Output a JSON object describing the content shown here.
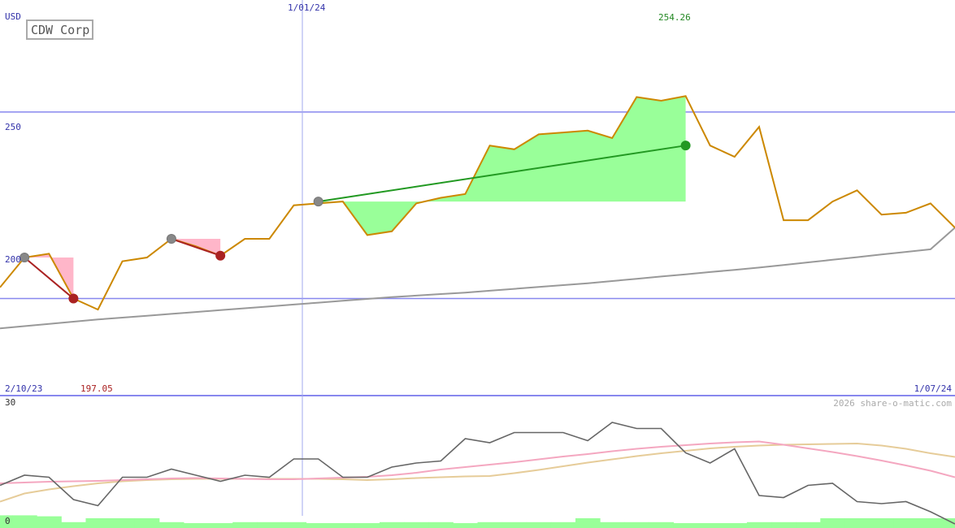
{
  "chart_data": [
    {
      "type": "line",
      "title": "CDW Corp",
      "ylabel": "USD",
      "ylim": [
        174,
        280
      ],
      "x_start_label": "2/10/23",
      "x_end_label": "1/07/24",
      "year_marker_label": "1/01/24",
      "yticks": [
        200,
        250
      ],
      "ytick_labels": [
        "200",
        "250"
      ],
      "max_label": "254.26",
      "min_label": "197.05",
      "grid": true,
      "series": [
        {
          "key": "price",
          "values": [
            203,
            211,
            212,
            200,
            197.05,
            210,
            211,
            216,
            214,
            211.5,
            216,
            216,
            225,
            225.5,
            226,
            217,
            218,
            225.5,
            227,
            228,
            241,
            240,
            244,
            244.5,
            245,
            243,
            254,
            253,
            254.26,
            241,
            238,
            246,
            221,
            221,
            226,
            229,
            222.5,
            223,
            225.5,
            219
          ]
        },
        {
          "key": "trend",
          "values": [
            192,
            192.6,
            193.2,
            193.8,
            194.4,
            194.9,
            195.4,
            195.9,
            196.4,
            196.9,
            197.4,
            197.9,
            198.4,
            198.9,
            199.4,
            199.9,
            200.4,
            200.8,
            201.2,
            201.6,
            202.1,
            202.6,
            203.1,
            203.6,
            204.1,
            204.7,
            205.3,
            205.9,
            206.5,
            207.1,
            207.7,
            208.3,
            209.0,
            209.7,
            210.4,
            211.1,
            211.8,
            212.5,
            213.2,
            219
          ]
        }
      ],
      "trades": [
        {
          "type": "loss",
          "start_index": 1,
          "end_index": 3,
          "start_value": 211,
          "end_value": 200
        },
        {
          "type": "loss",
          "start_index": 7,
          "end_index": 9,
          "start_value": 216,
          "end_value": 211.5
        },
        {
          "type": "gain",
          "start_index": 13,
          "end_index": 28,
          "start_value": 226,
          "end_value": 241
        }
      ]
    },
    {
      "type": "line",
      "ylim": [
        0,
        30
      ],
      "ytick_labels": [
        "30",
        "0"
      ],
      "credit": "2026 share-o-matic.com",
      "series": [
        {
          "key": "indicator",
          "values": [
            9.5,
            12,
            11.5,
            6,
            4.5,
            11.5,
            11.5,
            13.5,
            12,
            10.5,
            12,
            11.5,
            16,
            16,
            11.5,
            11.5,
            14,
            15,
            15.5,
            21,
            20,
            22.5,
            22.5,
            22.5,
            20.5,
            25,
            23.5,
            23.5,
            17.5,
            15,
            18.5,
            7,
            6.5,
            9.5,
            10,
            5.5,
            5,
            5.5,
            3,
            0
          ]
        },
        {
          "key": "average-fast",
          "values": [
            10,
            10.2,
            10.4,
            10.5,
            10.6,
            10.8,
            11,
            11.2,
            11.3,
            11.2,
            11.1,
            11,
            11,
            11.2,
            11.4,
            11.6,
            12,
            12.6,
            13.4,
            14,
            14.6,
            15.2,
            15.9,
            16.6,
            17.2,
            17.9,
            18.5,
            19,
            19.4,
            19.8,
            20.1,
            20.3,
            19.5,
            18.6,
            17.7,
            16.7,
            15.6,
            14.4,
            13.1,
            11.5
          ]
        },
        {
          "key": "average-slow",
          "values": [
            5.5,
            7.5,
            8.5,
            9.3,
            10,
            10.5,
            10.8,
            11,
            11.1,
            11.1,
            11.1,
            11.1,
            11.1,
            11.1,
            11,
            10.8,
            11,
            11.3,
            11.5,
            11.7,
            11.8,
            12.5,
            13.3,
            14.2,
            15.1,
            15.9,
            16.7,
            17.4,
            18,
            18.6,
            19,
            19.3,
            19.5,
            19.6,
            19.7,
            19.8,
            19.3,
            18.5,
            17.4,
            16.5
          ]
        }
      ],
      "volume": [
        1.3,
        1.3,
        1.2,
        0.6,
        1.0,
        1.0,
        1.0,
        0.6,
        0.5,
        0.5,
        0.6,
        0.6,
        0.6,
        0.5,
        0.5,
        0.5,
        0.6,
        0.6,
        0.6,
        0.5,
        0.6,
        0.6,
        0.6,
        0.6,
        1.0,
        0.6,
        0.6,
        0.6,
        0.5,
        0.5,
        0.5,
        0.6,
        0.6,
        0.6,
        1.0,
        1.0,
        1.0,
        1.0,
        1.0,
        1.0
      ]
    }
  ],
  "colors": {
    "price": "#cc8800",
    "trend": "#999999",
    "grid": "#8888ee",
    "year_marker": "#a0a8ee",
    "gain_fill": "#99ff99",
    "gain_line": "#229922",
    "loss_fill": "#ffb6c9",
    "loss_line": "#aa2222",
    "indicator": "#666666",
    "average_fast": "#f4a7c0",
    "average_slow": "#e6cc99",
    "volume": "#99ff99",
    "axis_label": "#3333aa",
    "max_label": "#228822",
    "min_label": "#aa2222",
    "credit": "#aaaaaa"
  }
}
